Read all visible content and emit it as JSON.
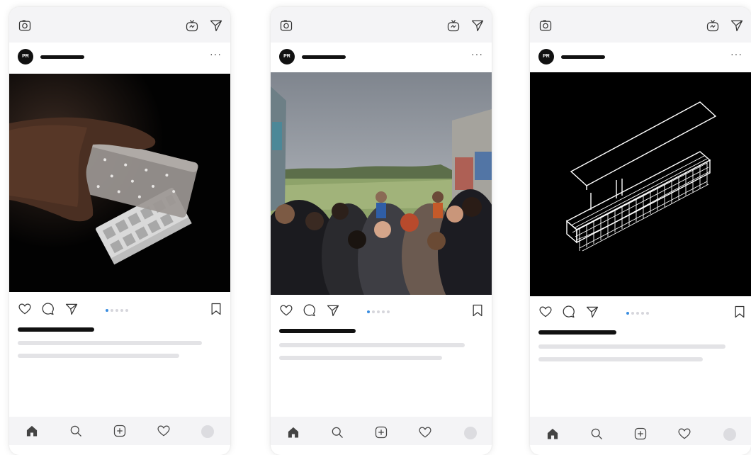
{
  "phones": [
    {
      "avatar_text": "PR",
      "more_label": "···",
      "image_subject": "hand lifting a translucent block with dots off a white grid-like model on black background",
      "carousel_index": 1,
      "carousel_count": 5
    },
    {
      "avatar_text": "PR",
      "more_label": "···",
      "image_subject": "group of students standing in a grassy field between graffiti walls under a cloudy sky",
      "carousel_index": 1,
      "carousel_count": 5
    },
    {
      "avatar_text": "PR",
      "more_label": "···",
      "image_subject": "white line axonometric drawing of a long structure with a flat plate above, on black background",
      "carousel_index": 1,
      "carousel_count": 5
    }
  ],
  "icons": {
    "top": [
      "camera-icon",
      "igtv-icon",
      "direct-message-icon"
    ],
    "actions": [
      "heart-icon",
      "comment-icon",
      "share-icon",
      "bookmark-icon"
    ],
    "nav": [
      "home-icon",
      "search-icon",
      "add-post-icon",
      "activity-heart-icon",
      "profile-avatar"
    ]
  },
  "colors": {
    "topbar_bg": "#f4f4f6",
    "active_dot": "#3a8de0",
    "inactive_dot": "#d6d6dc",
    "placeholder_line": "#e3e3e6",
    "ink": "#111111"
  }
}
